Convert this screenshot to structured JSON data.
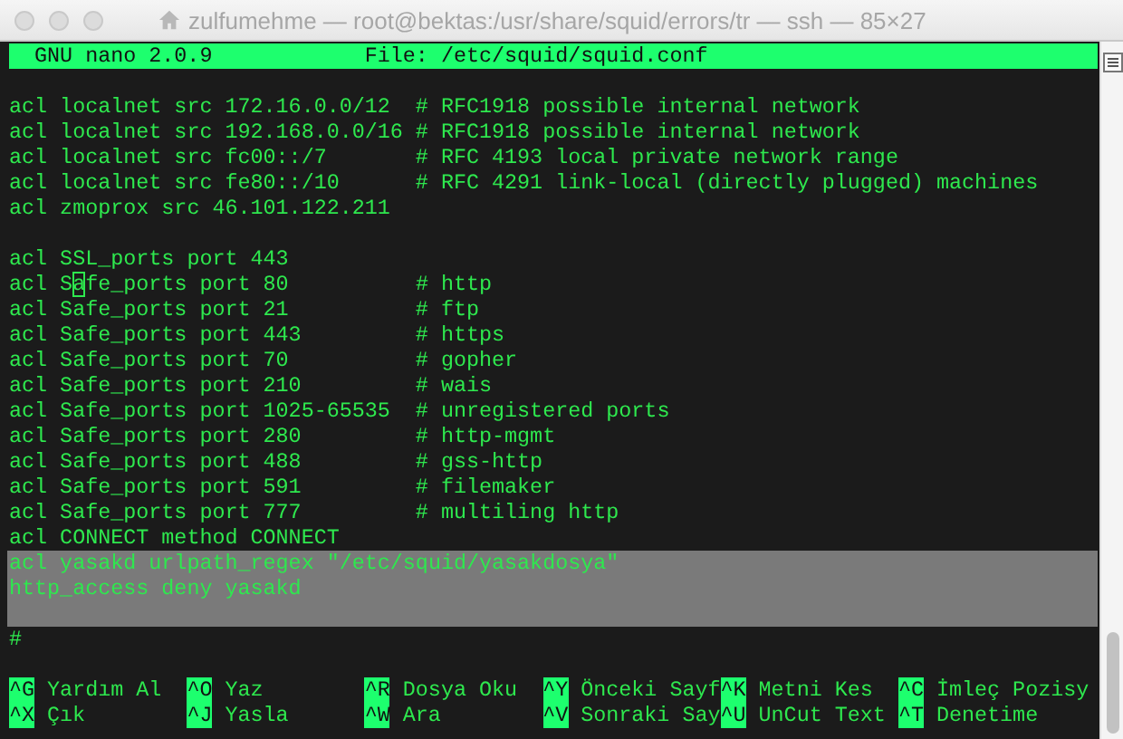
{
  "window": {
    "title": "zulfumehme — root@bektas:/usr/share/squid/errors/tr — ssh — 85×27"
  },
  "header": {
    "app": "GNU nano 2.0.9",
    "file": "File: /etc/squid/squid.conf"
  },
  "lines": [
    {
      "kind": "blank",
      "highlighted": false
    },
    {
      "kind": "text",
      "text": "acl localnet src 172.16.0.0/12  # RFC1918 possible internal network",
      "highlighted": false
    },
    {
      "kind": "text",
      "text": "acl localnet src 192.168.0.0/16 # RFC1918 possible internal network",
      "highlighted": false
    },
    {
      "kind": "text",
      "text": "acl localnet src fc00::/7       # RFC 4193 local private network range",
      "highlighted": false
    },
    {
      "kind": "text",
      "text": "acl localnet src fe80::/10      # RFC 4291 link-local (directly plugged) machines",
      "highlighted": false
    },
    {
      "kind": "text",
      "text": "acl zmoprox src 46.101.122.211",
      "highlighted": false
    },
    {
      "kind": "blank",
      "highlighted": false
    },
    {
      "kind": "text",
      "text": "acl SSL_ports port 443",
      "highlighted": false
    },
    {
      "kind": "cursor",
      "before": "acl S",
      "cursor": "a",
      "after": "fe_ports port 80          # http",
      "highlighted": false
    },
    {
      "kind": "text",
      "text": "acl Safe_ports port 21          # ftp",
      "highlighted": false
    },
    {
      "kind": "text",
      "text": "acl Safe_ports port 443         # https",
      "highlighted": false
    },
    {
      "kind": "text",
      "text": "acl Safe_ports port 70          # gopher",
      "highlighted": false
    },
    {
      "kind": "text",
      "text": "acl Safe_ports port 210         # wais",
      "highlighted": false
    },
    {
      "kind": "text",
      "text": "acl Safe_ports port 1025-65535  # unregistered ports",
      "highlighted": false
    },
    {
      "kind": "text",
      "text": "acl Safe_ports port 280         # http-mgmt",
      "highlighted": false
    },
    {
      "kind": "text",
      "text": "acl Safe_ports port 488         # gss-http",
      "highlighted": false
    },
    {
      "kind": "text",
      "text": "acl Safe_ports port 591         # filemaker",
      "highlighted": false
    },
    {
      "kind": "text",
      "text": "acl Safe_ports port 777         # multiling http",
      "highlighted": false
    },
    {
      "kind": "text",
      "text": "acl CONNECT method CONNECT",
      "highlighted": false
    },
    {
      "kind": "text",
      "text": "acl yasakd urlpath_regex \"/etc/squid/yasakdosya\"",
      "highlighted": true
    },
    {
      "kind": "text",
      "text": "http_access deny yasakd",
      "highlighted": true
    },
    {
      "kind": "blank",
      "highlighted": true
    },
    {
      "kind": "text",
      "text": "#",
      "highlighted": false
    },
    {
      "kind": "blank",
      "highlighted": false
    }
  ],
  "shortcuts": [
    {
      "key": "^G",
      "label": "Yardım Al"
    },
    {
      "key": "^O",
      "label": "Yaz"
    },
    {
      "key": "^R",
      "label": "Dosya Oku"
    },
    {
      "key": "^Y",
      "label": "Önceki Sayf"
    },
    {
      "key": "^K",
      "label": "Metni Kes"
    },
    {
      "key": "^C",
      "label": "İmleç Pozisy"
    },
    {
      "key": "^X",
      "label": "Çık"
    },
    {
      "key": "^J",
      "label": "Yasla"
    },
    {
      "key": "^W",
      "label": "Ara"
    },
    {
      "key": "^V",
      "label": "Sonraki Say"
    },
    {
      "key": "^U",
      "label": "UnCut Text"
    },
    {
      "key": "^T",
      "label": "Denetime"
    }
  ]
}
